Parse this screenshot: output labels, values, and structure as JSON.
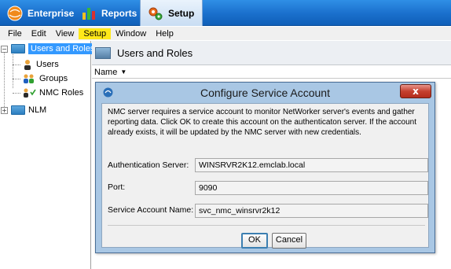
{
  "app_tabs": [
    {
      "label": "Enterprise",
      "icon": "globe-icon"
    },
    {
      "label": "Reports",
      "icon": "bar-chart-icon"
    },
    {
      "label": "Setup",
      "icon": "gears-icon",
      "active": true
    }
  ],
  "menu": [
    "File",
    "Edit",
    "View",
    "Setup",
    "Window",
    "Help"
  ],
  "menu_highlight": "Setup",
  "tree": {
    "root": "Users and Roles",
    "children": [
      "Users",
      "Groups",
      "NMC Roles"
    ],
    "second_root": "NLM"
  },
  "content": {
    "title": "Users and Roles",
    "column_header": "Name"
  },
  "dialog": {
    "title": "Configure Service Account",
    "close_label": "x",
    "message": "NMC server requires a service account to monitor NetWorker server's events and gather reporting data. Click OK to create this account on the authenticaton server. If the account already exists, it will be updated by the NMC server with new credentials.",
    "fields": [
      {
        "label": "Authentication Server:",
        "value": "WINSRVR2K12.emclab.local"
      },
      {
        "label": "Port:",
        "value": "9090"
      },
      {
        "label": "Service Account Name:",
        "value": "svc_nmc_winsrvr2k12"
      }
    ],
    "ok_label": "OK",
    "cancel_label": "Cancel"
  },
  "colors": {
    "toolbar": "#1a6fcc",
    "menu_highlight": "#ffe81a",
    "selection": "#3399ff",
    "dialog_frame": "#a9c7e4",
    "close_button": "#c5402f"
  }
}
